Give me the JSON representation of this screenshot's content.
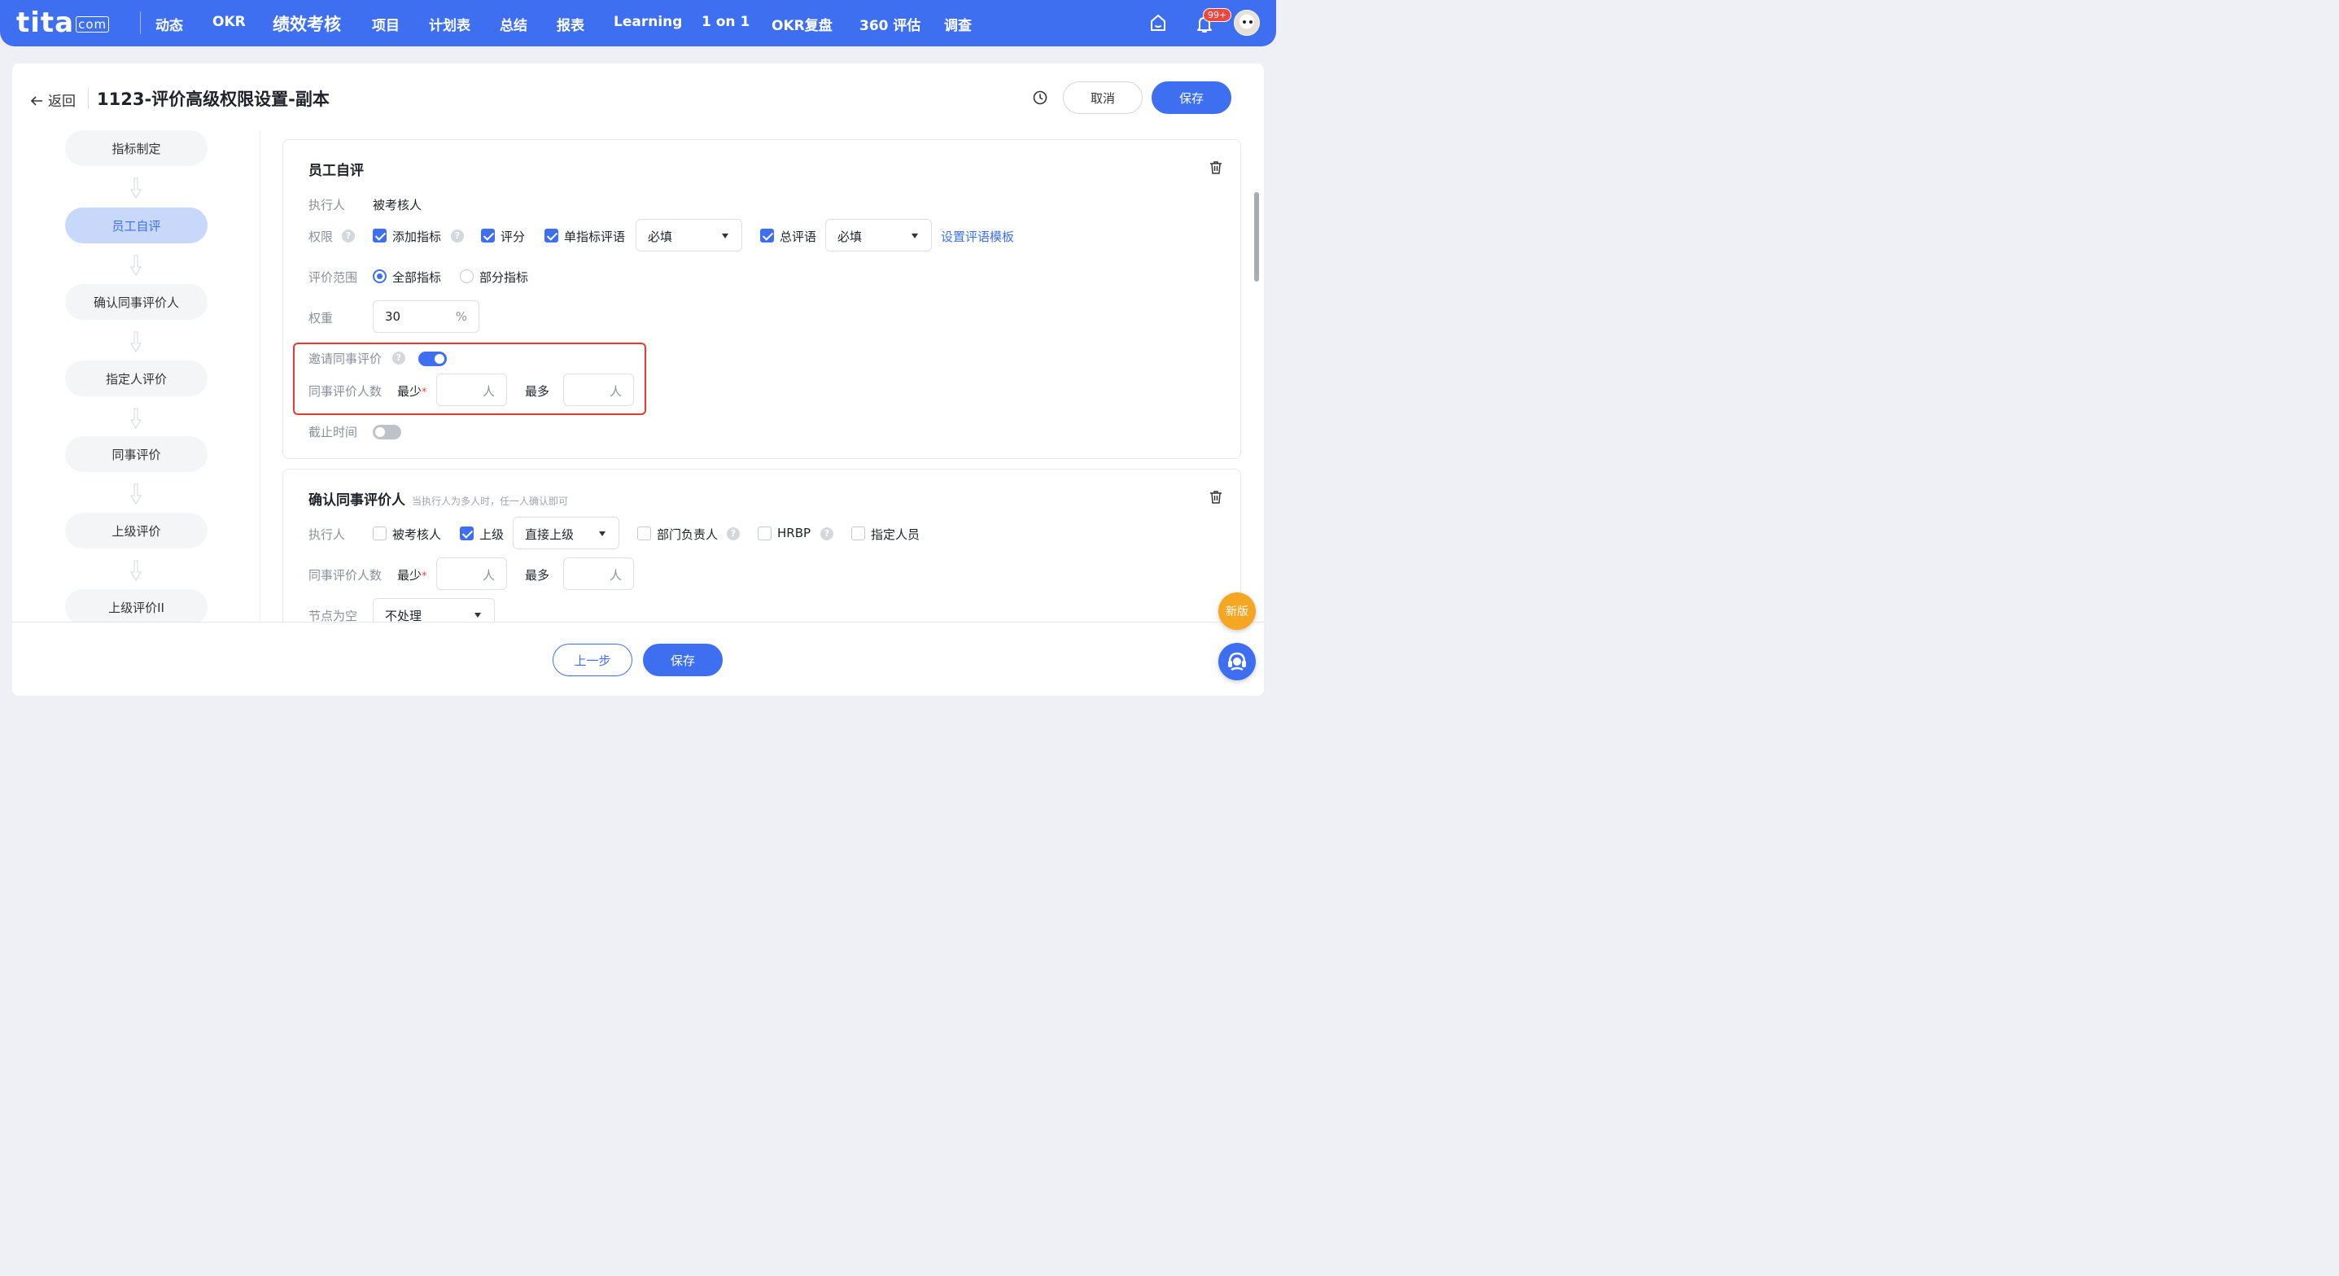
{
  "topnav": {
    "logo": "tita",
    "logo_suffix": "com",
    "items": [
      "动态",
      "OKR",
      "绩效考核",
      "项目",
      "计划表",
      "总结",
      "报表",
      "Learning",
      "1 on 1",
      "OKR复盘",
      "360 评估",
      "调查"
    ],
    "active_index": 2,
    "notification_badge": "99+",
    "icons": [
      "home-icon",
      "bell-icon",
      "avatar"
    ]
  },
  "header": {
    "back_label": "返回",
    "title": "1123-评价高级权限设置-副本",
    "cancel_label": "取消",
    "save_label": "保存"
  },
  "steps": [
    "指标制定",
    "员工自评",
    "确认同事评价人",
    "指定人评价",
    "同事评价",
    "上级评价",
    "上级评价II"
  ],
  "active_step": 1,
  "self_review": {
    "title": "员工自评",
    "executor_label": "执行人",
    "executor_value": "被考核人",
    "permission_label": "权限",
    "add_indicator": "添加指标",
    "score": "评分",
    "single_comment": "单指标评语",
    "single_comment_select": "必填",
    "total_comment": "总评语",
    "total_comment_select": "必填",
    "template_link": "设置评语模板",
    "scope_label": "评价范围",
    "scope_all": "全部指标",
    "scope_partial": "部分指标",
    "weight_label": "权重",
    "weight_value": "30",
    "weight_unit": "%",
    "invite_label": "邀请同事评价",
    "invite_enabled": true,
    "peer_count_label": "同事评价人数",
    "min_label": "最少",
    "required_mark": "*",
    "max_label": "最多",
    "person_unit": "人",
    "deadline_label": "截止时间",
    "deadline_enabled": false
  },
  "confirm_peer": {
    "title": "确认同事评价人",
    "hint": "当执行人为多人时，任一人确认即可",
    "executor_label": "执行人",
    "opt_reviewee": "被考核人",
    "opt_superior": "上级",
    "superior_select": "直接上级",
    "opt_dept_head": "部门负责人",
    "opt_hrbp": "HRBP",
    "opt_designated": "指定人员",
    "peer_count_label": "同事评价人数",
    "min_label": "最少",
    "required_mark": "*",
    "max_label": "最多",
    "person_unit": "人",
    "empty_node_label": "节点为空",
    "empty_node_select": "不处理"
  },
  "footer": {
    "prev_label": "上一步",
    "save_label": "保存"
  },
  "floating": {
    "new_version_label": "新版"
  },
  "colors": {
    "accent": "#3d6ff0",
    "highlight_border": "#e8392c",
    "badge": "#f0463c",
    "new_version": "#f5a623"
  }
}
